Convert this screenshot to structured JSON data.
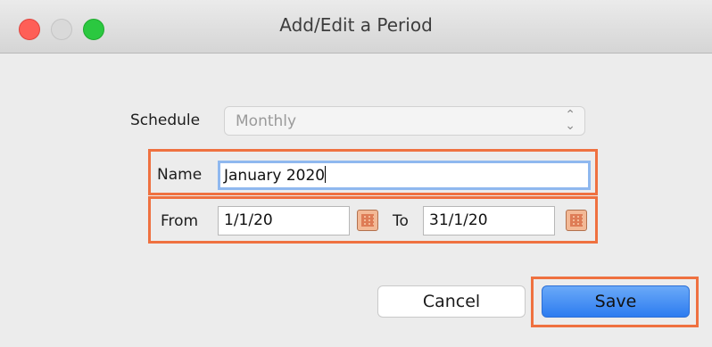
{
  "window": {
    "title": "Add/Edit a Period"
  },
  "form": {
    "schedule_label": "Schedule",
    "schedule_value": "Monthly",
    "name_label": "Name",
    "name_value": "January 2020",
    "from_label": "From",
    "from_value": "1/1/20",
    "to_label": "To",
    "to_value": "31/1/20"
  },
  "buttons": {
    "cancel": "Cancel",
    "save": "Save"
  },
  "icons": {
    "schedule_arrows": "chevron-up-down-icon",
    "from_calendar": "calendar-icon",
    "to_calendar": "calendar-icon"
  },
  "colors": {
    "highlight": "#ef7140",
    "save_button": "#2d7cf0",
    "close_light": "#fe5f57",
    "max_light": "#2bc840"
  }
}
